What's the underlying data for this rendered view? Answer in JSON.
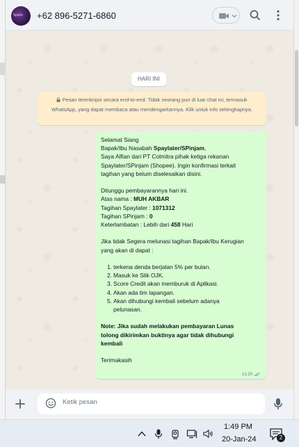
{
  "header": {
    "avatar_text": "Spalo",
    "contact_name": "+62 896-5271-6860"
  },
  "chat": {
    "date_label": "HARI INI",
    "encryption_notice": "Pesan terenkripsi secara end-to-end. Tidak seorang pun di luar chat ini, termasuk WhatsApp, yang dapat membaca atau mendengarkannya. Klik untuk info selengkapnya.",
    "message": {
      "greeting": "Selamat Siang",
      "l2_pre": "Bapak/Ibu Nasabah ",
      "l2_bold": "Spaylater/SPinjam",
      "l2_post": ",",
      "l3": "Saya Alfian dari PT Colmitra pihak ketiga rekanan",
      "l4": "Spaylater/SPinjam (Shopee). Ingin konfirmasi terkait",
      "l5": "tagihan yang belum diselesaikan disini.",
      "l6": "Ditunggu pembayarannya hari ini.",
      "l7_label": "Atas nama : ",
      "l7_value": "MUH AKBAR",
      "l8_label": "Tagihan Spaylater : ",
      "l8_value": "1071312",
      "l9_label": "Tagihan SPinjam : ",
      "l9_value": "0",
      "l10_label": "Keterlambatan :  Lebih dari ",
      "l10_value": "458",
      "l10_post": " Hari",
      "l11": "Jika tidak Segera melunasi tagihan Bapak/Ibu Kerugian",
      "l12": "yang akan di dapat :",
      "items": [
        {
          "num": "1.",
          "text": "terkena denda berjalan 5% per bulan."
        },
        {
          "num": "2.",
          "text": "Masuk ke Slik OJK."
        },
        {
          "num": "3.",
          "text": "Score Credit akan memburuk di Aplikasi."
        },
        {
          "num": "4.",
          "text": "Akan ada tim lapangan."
        },
        {
          "num": "5.",
          "text": "Akan dihubungi kembali sebelum adanya"
        },
        {
          "num": "",
          "text": "pelunasan."
        }
      ],
      "note1": "Note: Jika sudah melakukan pembayaran Lunas",
      "note2": "tolong dikirimkan buktinya agar tidak dihubungi",
      "note3": "kembali",
      "closing": "Terimakasih",
      "time": "13.20"
    }
  },
  "composer": {
    "placeholder": "Ketik pesan"
  },
  "taskbar": {
    "time": "1:49 PM",
    "date": "20-Jan-24",
    "notification_count": "2"
  },
  "colors": {
    "bubble": "#d9fdd3",
    "notice": "#ffeecd",
    "chat_bg": "#efeae2"
  }
}
